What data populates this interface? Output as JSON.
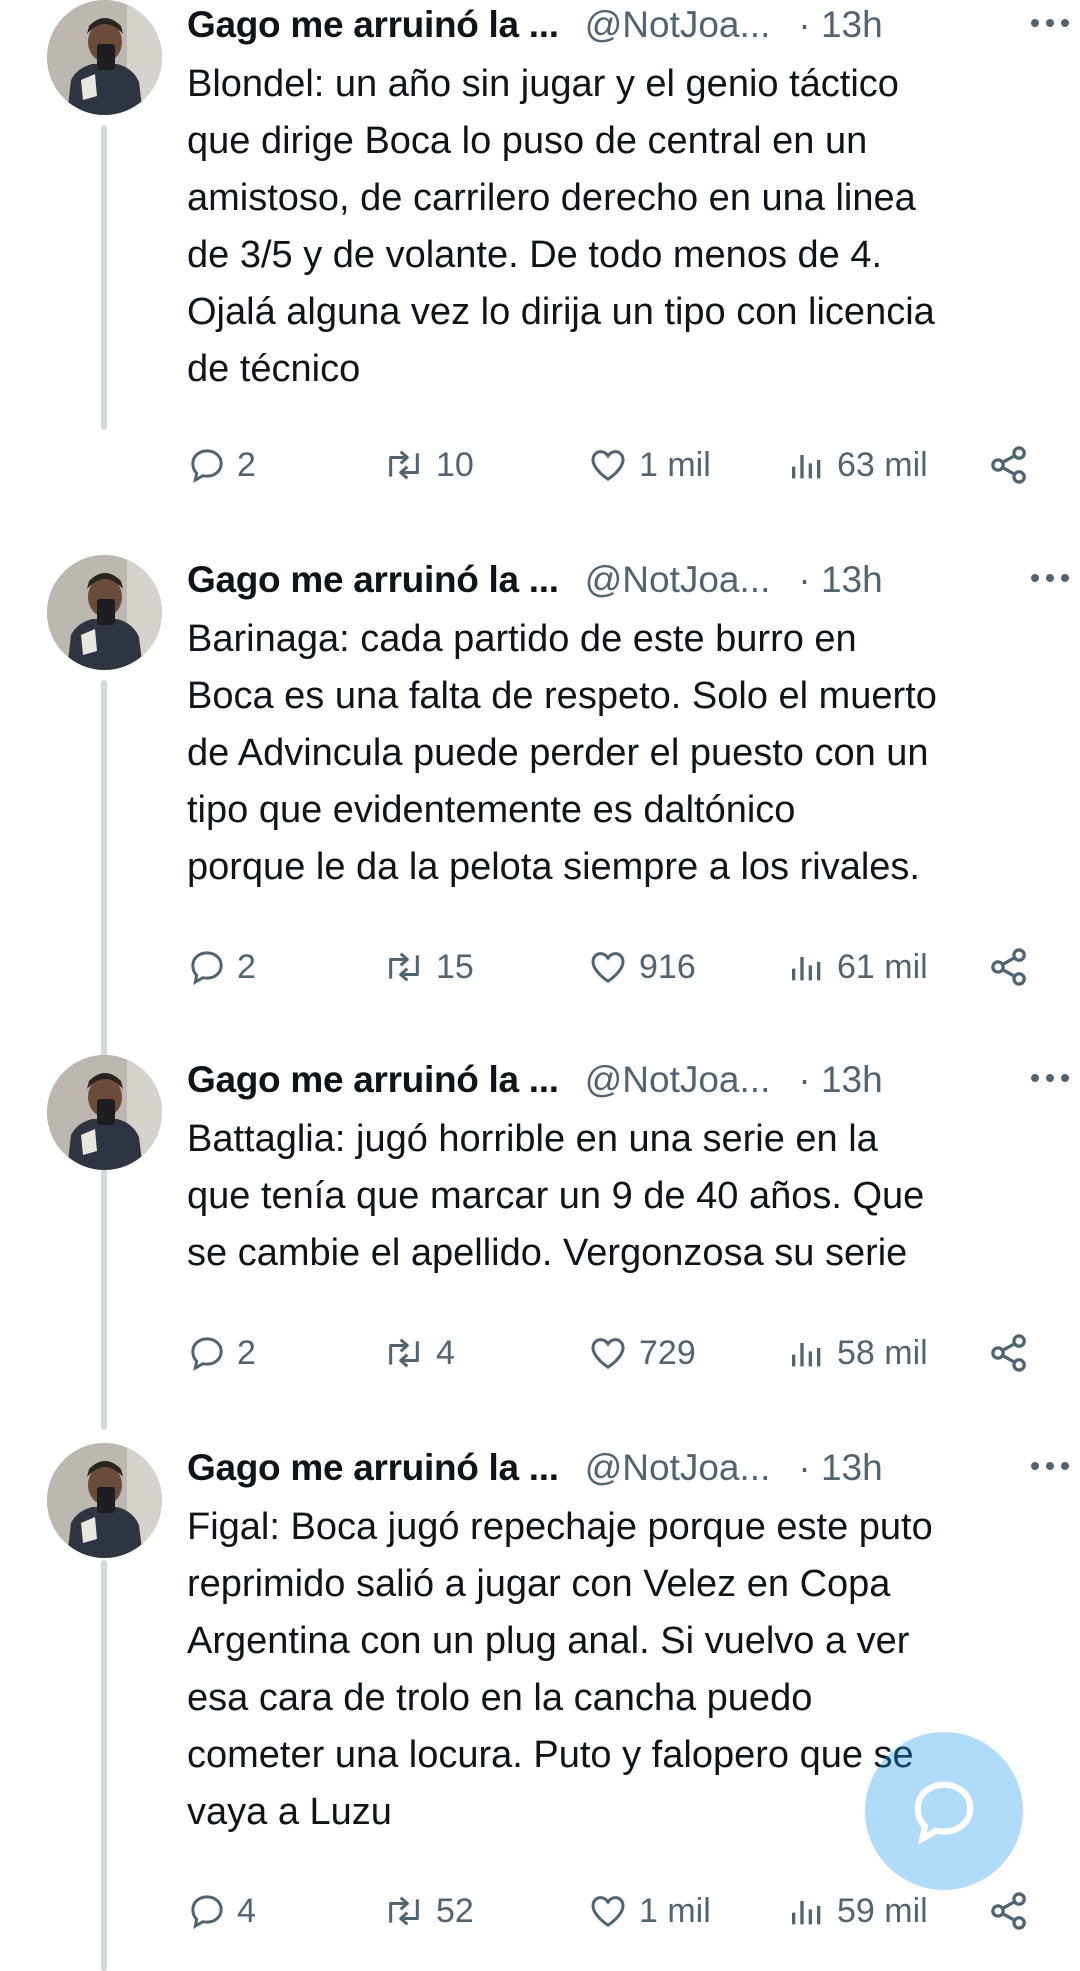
{
  "tweets": [
    {
      "author": "Gago me arruinó la ...",
      "handle": "@NotJoa...",
      "time": "· 13h",
      "text": "Blondel: un año sin jugar y el genio táctico\nque dirige Boca lo puso de central en un\namistoso, de carrilero derecho en una linea\nde 3/5 y de volante. De todo menos de 4.\nOjalá alguna vez lo dirija un tipo con licencia\nde técnico",
      "replies": "2",
      "retweets": "10",
      "likes": "1 mil",
      "views": "63 mil"
    },
    {
      "author": "Gago me arruinó la ...",
      "handle": "@NotJoa...",
      "time": "· 13h",
      "text": "Barinaga: cada partido de este burro en\nBoca es una falta de respeto. Solo el muerto\nde Advincula puede perder el puesto con un\ntipo que evidentemente es daltónico\nporque le da la pelota siempre a los rivales.",
      "replies": "2",
      "retweets": "15",
      "likes": "916",
      "views": "61 mil"
    },
    {
      "author": "Gago me arruinó la ...",
      "handle": "@NotJoa...",
      "time": "· 13h",
      "text": "Battaglia: jugó horrible en una serie en la\nque tenía que marcar un 9 de 40 años. Que\nse cambie el apellido. Vergonzosa su serie",
      "replies": "2",
      "retweets": "4",
      "likes": "729",
      "views": "58 mil"
    },
    {
      "author": "Gago me arruinó la ...",
      "handle": "@NotJoa...",
      "time": "· 13h",
      "text": "Figal: Boca jugó repechaje porque este puto\nreprimido salió a jugar con Velez en Copa\nArgentina con un plug anal. Si vuelvo a ver\nesa cara de trolo en la cancha puedo\ncometer una locura. Puto y falopero que se\nvaya a Luzu",
      "replies": "4",
      "retweets": "52",
      "likes": "1 mil",
      "views": "59 mil"
    }
  ],
  "icons": {
    "reply": "reply-icon",
    "retweet": "retweet-icon",
    "like": "heart-icon",
    "views": "views-icon",
    "share": "share-icon",
    "more": "more-icon",
    "compose": "compose-reply-icon"
  },
  "colors": {
    "text": "#0f1419",
    "secondary": "#536471",
    "thread_line": "#cfd9de",
    "fab": "#1d9bf0"
  }
}
